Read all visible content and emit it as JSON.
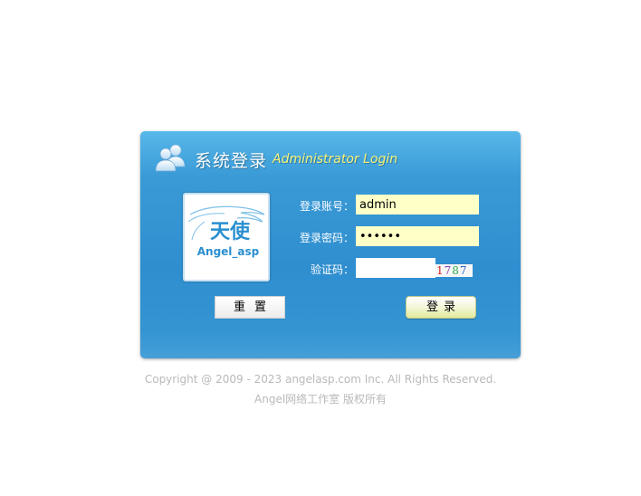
{
  "header": {
    "title_cn": "系统登录",
    "title_en": "Administrator Login",
    "icon": "users-icon"
  },
  "logo": {
    "text_cn": "天使",
    "text_en": "Angel_asp",
    "color": "#2a8fd0"
  },
  "form": {
    "account_label": "登录账号：",
    "account_value": "admin",
    "password_label": "登录密码：",
    "password_value": "123456",
    "captcha_label": "验证码：",
    "captcha_value": "",
    "captcha_digits": [
      {
        "char": "1",
        "color": "#d81e1e"
      },
      {
        "char": "7",
        "color": "#8a3fb8"
      },
      {
        "char": "8",
        "color": "#2fa84f"
      },
      {
        "char": "7",
        "color": "#2a62c9"
      }
    ],
    "input_bg": "#ffffc8"
  },
  "buttons": {
    "reset_label": "重置",
    "login_label": "登录"
  },
  "footer": {
    "copyright": "Copyright @ 2009 - 2023 angelasp.com Inc. All Rights Reserved.",
    "studio": "Angel网络工作室 版权所有"
  },
  "colors": {
    "panel": "#3393d2",
    "title_en": "#f3f27a",
    "footer_text": "#b9b9b9"
  }
}
